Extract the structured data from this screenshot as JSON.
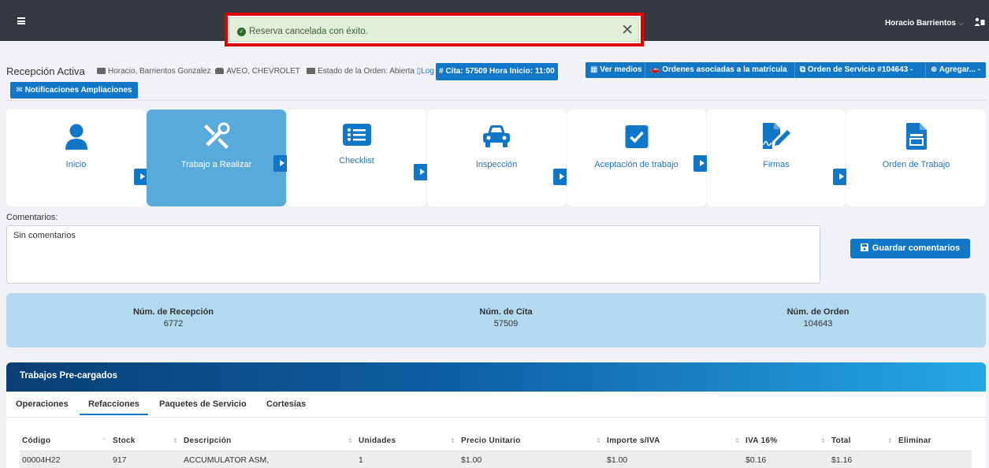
{
  "topbar": {
    "user_name": "Horacio Barrientos",
    "user_chevron": "⌵",
    "icons": [
      "menu-icon",
      "user-book-icon"
    ]
  },
  "toast": {
    "message": "Reserva cancelada con éxito.",
    "close": "✕",
    "color": "#e2efd9",
    "highlight_border": "#e00000"
  },
  "header": {
    "title": "Recepción Activa",
    "customer": "Horacio, Barrientos Gonzalez",
    "vehicle": "AVEO, CHEVROLET",
    "order_status": "Estado de la Orden: Abierta",
    "log_link": "Log",
    "cita_button": "# Cita: 57509 Hora Inicio: 11:00",
    "notif_button": "Notificaciones Ampliaciones",
    "actions": [
      "Ver medios",
      "Ordenes asociadas a la matrícula",
      "Orden de Servicio #104643 -",
      "Agregar... -"
    ]
  },
  "steps": [
    {
      "label": "Inicio",
      "icon": "user-icon"
    },
    {
      "label": "Trabajo a Realizar",
      "icon": "tools-icon",
      "active": true
    },
    {
      "label": "Checklist",
      "icon": "list-icon"
    },
    {
      "label": "Inspección",
      "icon": "car-icon"
    },
    {
      "label": "Aceptación de trabajo",
      "icon": "check-square-icon"
    },
    {
      "label": "Firmas",
      "icon": "signature-icon"
    },
    {
      "label": "Orden de Trabajo",
      "icon": "document-icon"
    }
  ],
  "comments": {
    "label": "Comentarios:",
    "value": "Sin comentarios",
    "save_button": "Guardar comentarios"
  },
  "numbers": [
    {
      "label": "Núm. de Recepción",
      "value": "6772"
    },
    {
      "label": "Núm. de Cita",
      "value": "57509"
    },
    {
      "label": "Núm. de Orden",
      "value": "104643"
    }
  ],
  "preloaded": {
    "title": "Trabajos Pre-cargados",
    "tabs": [
      "Operaciones",
      "Refacciones",
      "Paquetes de Servicio",
      "Cortesías"
    ],
    "active_tab": "Refacciones",
    "columns": [
      "Código",
      "Stock",
      "Descripción",
      "Unidades",
      "Precio Unitario",
      "Importe s/IVA",
      "IVA 16%",
      "Total",
      "Eliminar"
    ],
    "rows": [
      [
        "00004H22",
        "917",
        "ACCUMULATOR ASM,",
        "1",
        "$1.00",
        "$1.00",
        "$0.16",
        "$1.16",
        ""
      ]
    ]
  },
  "colors": {
    "primary": "#1177c6",
    "active_step": "#58aadb",
    "topbar": "#343a40"
  }
}
